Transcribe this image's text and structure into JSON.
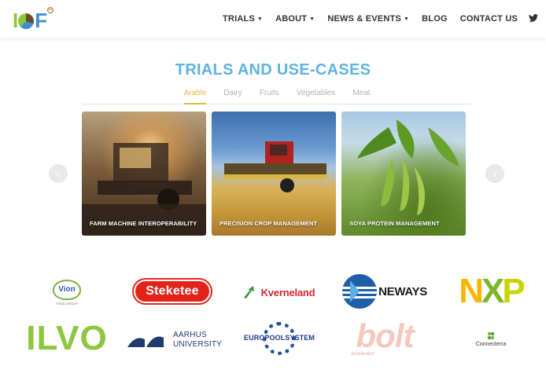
{
  "header": {
    "logo_text": "IOF",
    "logo_reg": "R",
    "nav": [
      {
        "label": "TRIALS",
        "dropdown": true
      },
      {
        "label": "ABOUT",
        "dropdown": true
      },
      {
        "label": "NEWS & EVENTS",
        "dropdown": true
      },
      {
        "label": "BLOG",
        "dropdown": false
      },
      {
        "label": "CONTACT US",
        "dropdown": false
      }
    ],
    "twitter_icon": "twitter-icon"
  },
  "section": {
    "title": "TRIALS AND USE-CASES",
    "tabs": [
      "Arable",
      "Dairy",
      "Fruits",
      "Vegetables",
      "Meat"
    ],
    "active_tab": "Arable"
  },
  "carousel": {
    "prev_icon": "chevron-left-icon",
    "next_icon": "chevron-right-icon",
    "cards": [
      {
        "caption": "FARM MACHINE INTEROPERABILITY"
      },
      {
        "caption": "PRECISION CROP MANAGEMENT"
      },
      {
        "caption": "SOYA PROTEIN MANAGEMENT"
      }
    ]
  },
  "partners": {
    "vion": {
      "name": "Vion",
      "sub": "FOOD GROUP"
    },
    "steketee": "Steketee",
    "kverneland": "Kverneland",
    "neways": "NEWAYS",
    "nxp": {
      "n": "N",
      "x": "X",
      "p": "P"
    },
    "ilvo": "ILVO",
    "aarhus": {
      "line1": "AARHUS",
      "line2": "UNIVERSITY"
    },
    "europool": "EUROPOOLSYSTEM",
    "bolt": {
      "name": "bolt",
      "sub": "accelerator"
    },
    "connecterra": "Connecterra"
  },
  "colors": {
    "accent_blue": "#5fb4de",
    "active_tab": "#e8b84f",
    "green": "#8dc63f"
  }
}
